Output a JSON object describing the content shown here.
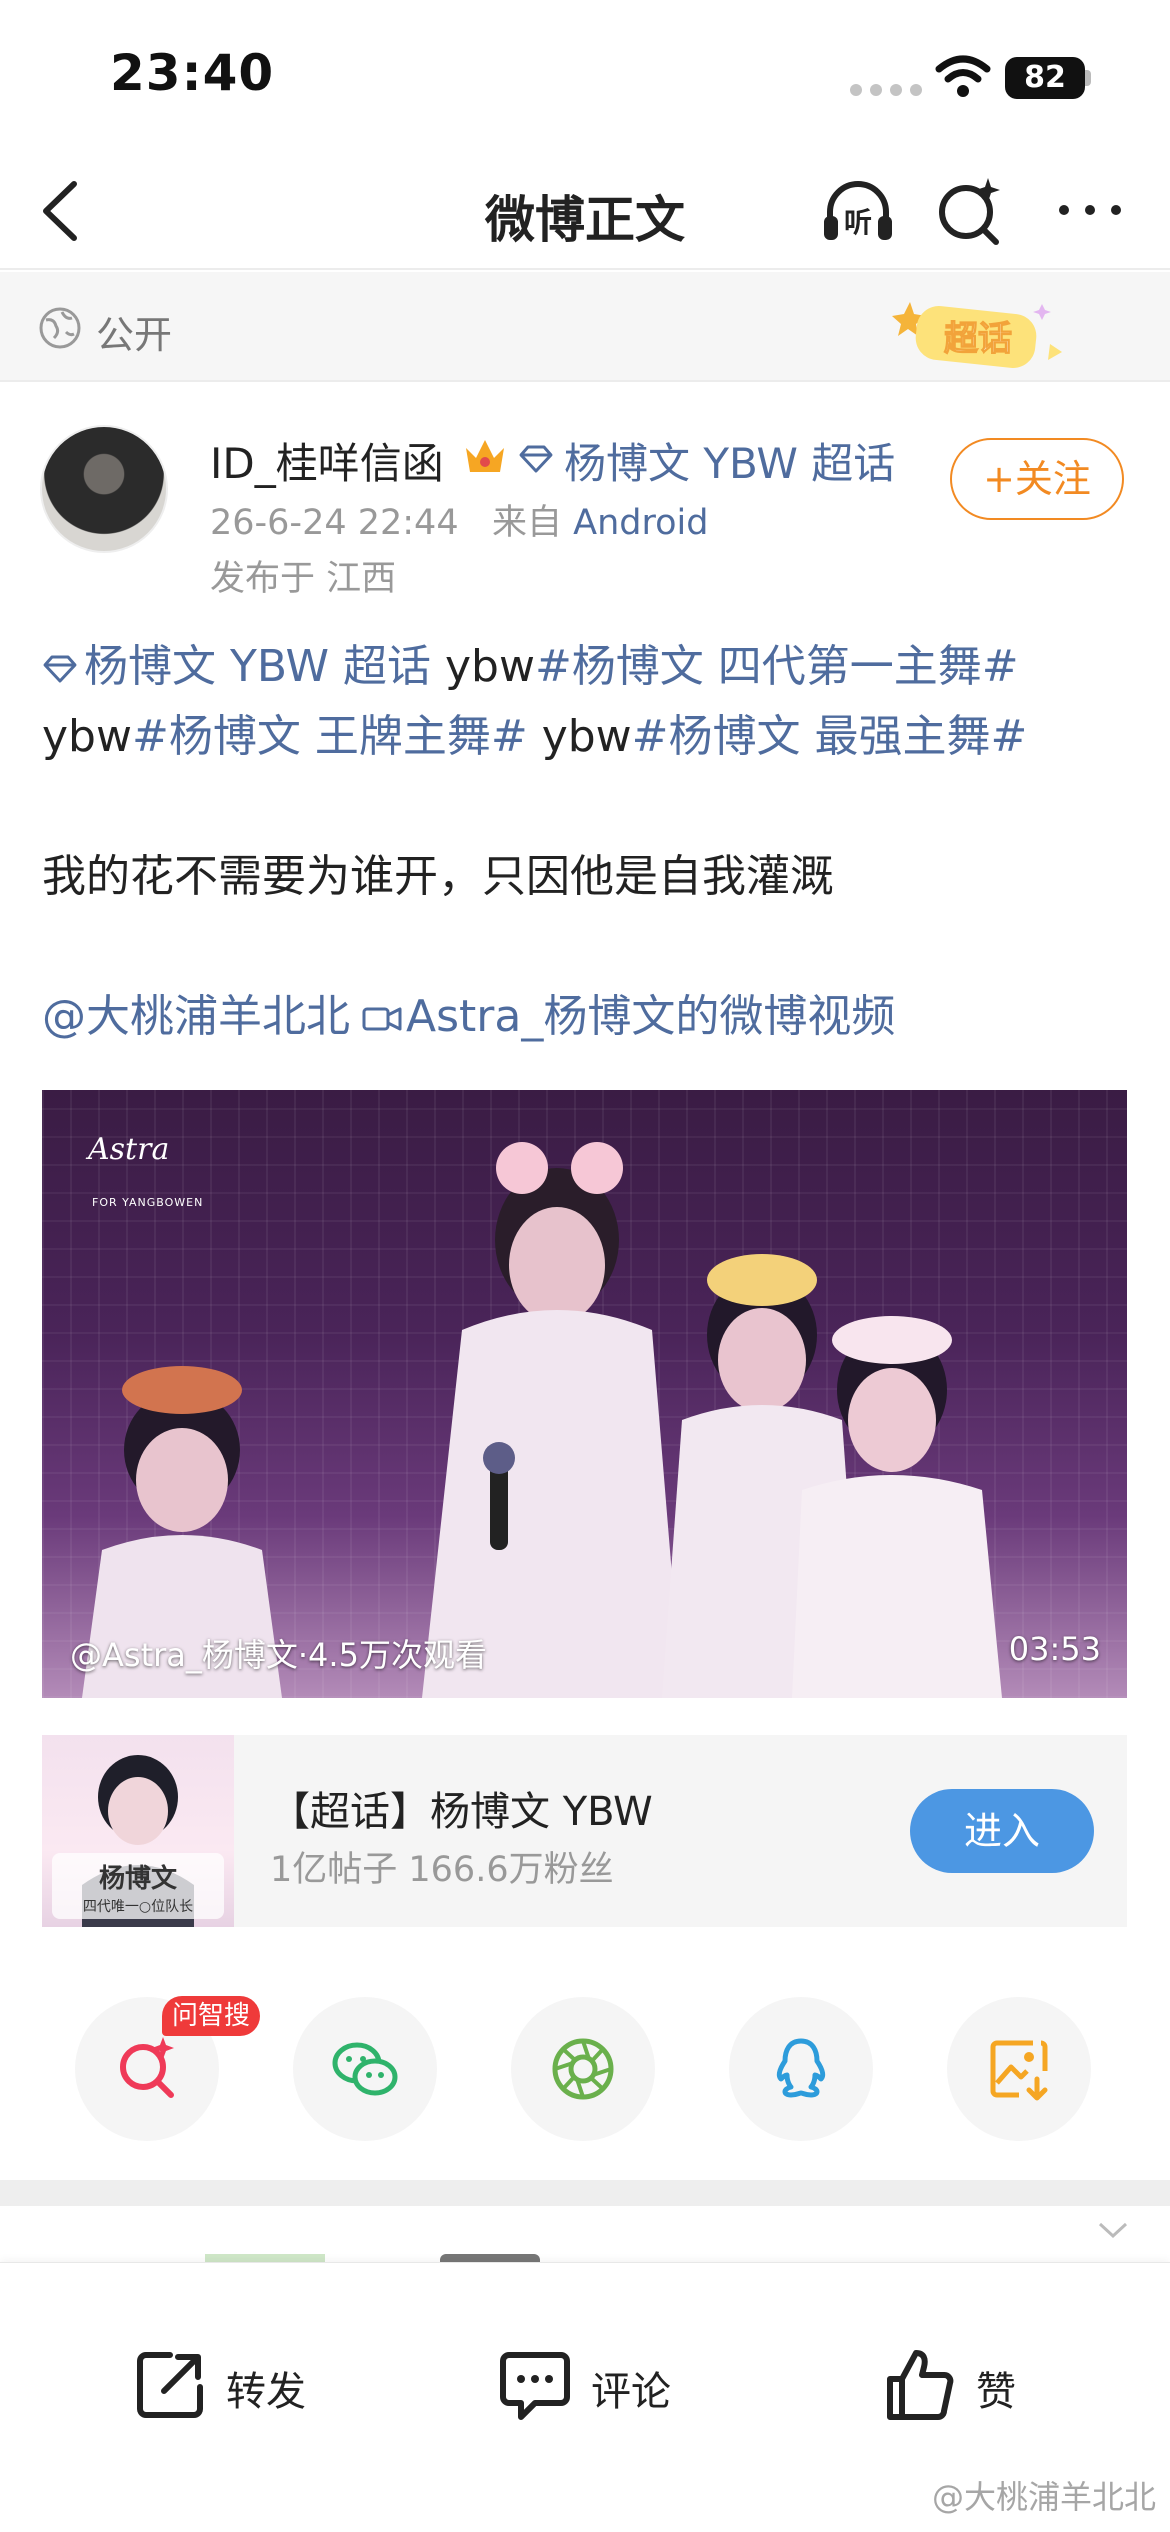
{
  "status_bar": {
    "time": "23:40",
    "battery": "82"
  },
  "nav": {
    "title": "微博正文",
    "listen_icon_label": "听"
  },
  "visibility": {
    "label": "公开",
    "supertopic_tag": "超话"
  },
  "author": {
    "name": "ID_桂咩信函",
    "topic": "杨博文 YBW 超话",
    "datetime": "26-6-24 22:44",
    "source_prefix": "来自",
    "source": "Android",
    "location": "发布于 江西",
    "follow_label": "+关注"
  },
  "post": {
    "line1": {
      "topic": "杨博文 YBW 超话",
      "text1": " ybw",
      "hashtag1": "#杨博文 四代第一主舞#"
    },
    "line2": {
      "text1": "ybw",
      "hashtag1": "#杨博文 王牌主舞#",
      "text2": " ybw",
      "hashtag2": "#杨博文 最强主舞#"
    },
    "body": "我的花不需要为谁开，只因他是自我灌溉",
    "mention": "@大桃浦羊北北",
    "video_link": "Astra_杨博文的微博视频"
  },
  "video": {
    "logo": "Astra",
    "logo_sub": "FOR YANGBOWEN",
    "caption": "@Astra_杨博文·4.5万次观看",
    "duration": "03:53"
  },
  "topic_card": {
    "title": "【超话】杨博文 YBW",
    "stats": "1亿帖子 166.6万粉丝",
    "enter_label": "进入",
    "thumb_name": "杨博文",
    "thumb_sub": "四代唯一○位队长"
  },
  "share": {
    "ai_badge": "问智搜"
  },
  "actions": {
    "repost": "转发",
    "comment": "评论",
    "like": "赞"
  },
  "watermark": "@大桃浦羊北北"
}
